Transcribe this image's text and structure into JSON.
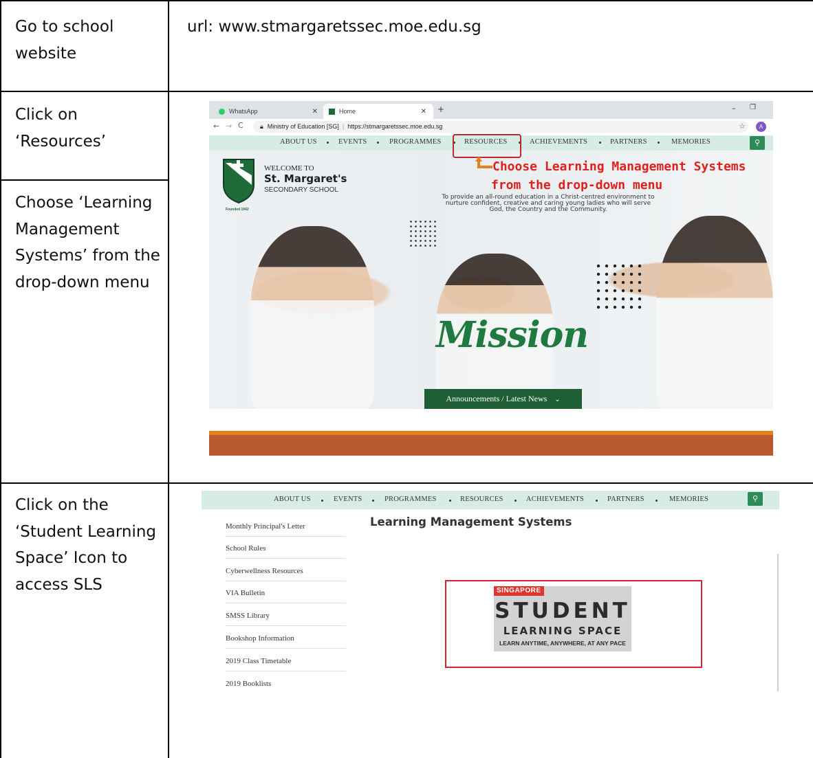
{
  "steps": [
    {
      "instruction": "Go to school website",
      "detail": "url: www.stmargaretssec.moe.edu.sg"
    },
    {
      "instruction": "Click on ‘Resources’"
    },
    {
      "instruction": "Choose ‘Learning Management Systems’ from the drop-down menu"
    },
    {
      "instruction": "Click on the ‘Student Learning Space’ Icon to access SLS"
    }
  ],
  "browser": {
    "tabs": [
      "WhatsApp",
      "Home"
    ],
    "address_site": "Ministry of Education [SG]",
    "address_url": "https://stmargaretssec.moe.edu.sg"
  },
  "nav": [
    "ABOUT US",
    "EVENTS",
    "PROGRAMMES",
    "RESOURCES",
    "ACHIEVEMENTS",
    "PARTNERS",
    "MEMORIES"
  ],
  "hero": {
    "welcome": "WELCOME TO",
    "school_name": "St. Margaret's",
    "school_type": "SECONDARY SCHOOL",
    "founded": "Founded 1942",
    "mission_statement": "To provide an all-round education in a Christ-centred environment to nurture confident, creative and caring young ladies who will serve God, the Country and the Community.",
    "mission_word": "Mission",
    "news_button": "Announcements / Latest News"
  },
  "callout": {
    "line1": "Choose Learning Management Systems",
    "line2": "from the drop-down menu"
  },
  "resources_page": {
    "title": "Learning Management Systems",
    "sidebar": [
      "Monthly Principal's Letter",
      "School Rules",
      "Cyberwellness Resources",
      "VIA Bulletin",
      "SMSS Library",
      "Bookshop Information",
      "2019 Class Timetable",
      "2019 Booklists"
    ]
  },
  "sls_logo": {
    "tag": "SINGAPORE",
    "big": "STUDENT",
    "mid": "LEARNING SPACE",
    "tagline": "LEARN ANYTIME, ANYWHERE, AT ANY PACE"
  },
  "colors": {
    "nav_bg": "#d7ece4",
    "school_green": "#1f6b3a",
    "callout_red": "#e0201c",
    "band_brown": "#b85a2e",
    "band_orange": "#e67e22"
  }
}
